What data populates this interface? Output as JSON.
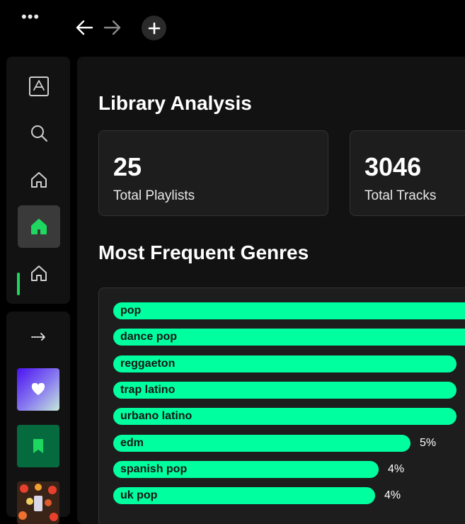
{
  "topbar": {
    "menu_icon": "more-horizontal-icon",
    "back_icon": "arrow-left-icon",
    "forward_icon": "arrow-right-icon",
    "new_icon": "plus-icon"
  },
  "sidebar": {
    "items": [
      {
        "icon": "marketplace-icon",
        "active": false
      },
      {
        "icon": "search-icon",
        "active": false
      },
      {
        "icon": "home-icon",
        "active": false
      },
      {
        "icon": "home-icon",
        "active": true
      },
      {
        "icon": "home-icon",
        "active": false
      }
    ],
    "accent": "#1ed760"
  },
  "library": {
    "expand_icon": "arrow-right-icon",
    "items": [
      {
        "name": "liked-songs-tile",
        "icon": "heart-icon"
      },
      {
        "name": "saved-episodes-tile",
        "icon": "bookmark-icon"
      },
      {
        "name": "playlist-cover-tile",
        "icon": "playlist-cover"
      }
    ]
  },
  "main": {
    "title": "Library Analysis",
    "stats": [
      {
        "value": "25",
        "label": "Total Playlists"
      },
      {
        "value": "3046",
        "label": "Total Tracks"
      }
    ],
    "genres_title": "Most Frequent Genres",
    "bar_color": "#00ff9f",
    "genres": [
      {
        "name": "pop",
        "percent": null,
        "fill": 1.0
      },
      {
        "name": "dance pop",
        "percent": null,
        "fill": 1.0
      },
      {
        "name": "reggaeton",
        "percent": null,
        "fill": 0.97
      },
      {
        "name": "trap latino",
        "percent": null,
        "fill": 0.97
      },
      {
        "name": "urbano latino",
        "percent": null,
        "fill": 0.97
      },
      {
        "name": "edm",
        "percent": "5%",
        "fill": 0.84
      },
      {
        "name": "spanish pop",
        "percent": "4%",
        "fill": 0.75
      },
      {
        "name": "uk pop",
        "percent": "4%",
        "fill": 0.74
      }
    ]
  }
}
